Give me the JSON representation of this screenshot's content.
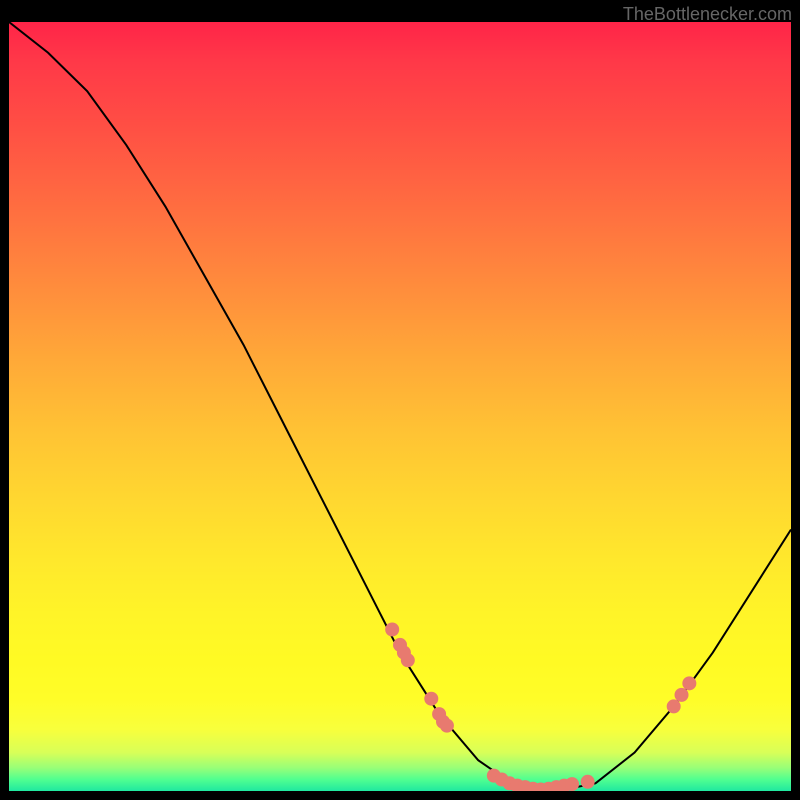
{
  "watermark": "TheBottlenecker.com",
  "chart_data": {
    "type": "line",
    "title": "",
    "xlabel": "",
    "ylabel": "",
    "curve_points": [
      {
        "x": 0,
        "y": 100
      },
      {
        "x": 5,
        "y": 96
      },
      {
        "x": 10,
        "y": 91
      },
      {
        "x": 15,
        "y": 84
      },
      {
        "x": 20,
        "y": 76
      },
      {
        "x": 25,
        "y": 67
      },
      {
        "x": 30,
        "y": 58
      },
      {
        "x": 35,
        "y": 48
      },
      {
        "x": 40,
        "y": 38
      },
      {
        "x": 45,
        "y": 28
      },
      {
        "x": 50,
        "y": 18
      },
      {
        "x": 55,
        "y": 10
      },
      {
        "x": 60,
        "y": 4
      },
      {
        "x": 65,
        "y": 0.5
      },
      {
        "x": 70,
        "y": 0
      },
      {
        "x": 75,
        "y": 1
      },
      {
        "x": 80,
        "y": 5
      },
      {
        "x": 85,
        "y": 11
      },
      {
        "x": 90,
        "y": 18
      },
      {
        "x": 95,
        "y": 26
      },
      {
        "x": 100,
        "y": 34
      }
    ],
    "markers": [
      {
        "x": 49,
        "y": 21
      },
      {
        "x": 50,
        "y": 19
      },
      {
        "x": 50.5,
        "y": 18
      },
      {
        "x": 51,
        "y": 17
      },
      {
        "x": 54,
        "y": 12
      },
      {
        "x": 55,
        "y": 10
      },
      {
        "x": 55.5,
        "y": 9
      },
      {
        "x": 56,
        "y": 8.5
      },
      {
        "x": 62,
        "y": 2
      },
      {
        "x": 63,
        "y": 1.5
      },
      {
        "x": 64,
        "y": 1
      },
      {
        "x": 65,
        "y": 0.7
      },
      {
        "x": 66,
        "y": 0.5
      },
      {
        "x": 67,
        "y": 0.3
      },
      {
        "x": 68,
        "y": 0.2
      },
      {
        "x": 69,
        "y": 0.3
      },
      {
        "x": 70,
        "y": 0.5
      },
      {
        "x": 71,
        "y": 0.7
      },
      {
        "x": 72,
        "y": 0.9
      },
      {
        "x": 74,
        "y": 1.2
      },
      {
        "x": 85,
        "y": 11
      },
      {
        "x": 86,
        "y": 12.5
      },
      {
        "x": 87,
        "y": 14
      }
    ],
    "xlim": [
      0,
      100
    ],
    "ylim": [
      0,
      100
    ]
  }
}
